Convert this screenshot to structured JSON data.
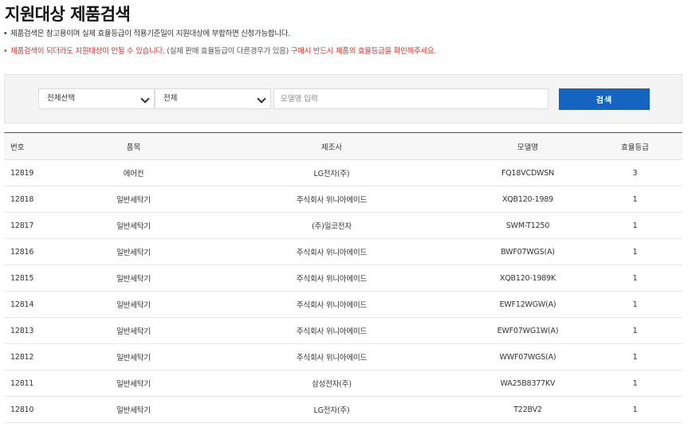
{
  "page": {
    "title": "지원대상 제품검색",
    "notes": {
      "line1": "제품검색은 참고용이며 실제 효율등급이 적용기준일이 지원대상에 부합하면 신청가능합니다.",
      "line2_red1": "제품검색이 되더라도 지원대상이 안될 수 있습니다.",
      "line2_gray": " (실제 판매 효율등급이 다른경우가 있음) ",
      "line2_red2": "구매시 반드시 제품의 효율등급을 확인해주세요."
    }
  },
  "search": {
    "select1_value": "전체선택",
    "select2_value": "전체",
    "model_placeholder": "모델명 입력",
    "button_label": "검색"
  },
  "table": {
    "headers": {
      "no": "번호",
      "item": "품목",
      "maker": "제조사",
      "model": "모델명",
      "grade": "효율등급"
    },
    "rows": [
      {
        "no": "12819",
        "item": "에어컨",
        "maker": "LG전자(주)",
        "model": "FQ18VCDWSN",
        "grade": "3"
      },
      {
        "no": "12818",
        "item": "일반세탁기",
        "maker": "주식회사 위니아에이드",
        "model": "XQB120-1989",
        "grade": "1"
      },
      {
        "no": "12817",
        "item": "일반세탁기",
        "maker": "(주)일코전자",
        "model": "SWM-T1250",
        "grade": "1"
      },
      {
        "no": "12816",
        "item": "일반세탁기",
        "maker": "주식회사 위니아에이드",
        "model": "BWF07WGS(A)",
        "grade": "1"
      },
      {
        "no": "12815",
        "item": "일반세탁기",
        "maker": "주식회사 위니아에이드",
        "model": "XQB120-1989K",
        "grade": "1"
      },
      {
        "no": "12814",
        "item": "일반세탁기",
        "maker": "주식회사 위니아에이드",
        "model": "EWF12WGW(A)",
        "grade": "1"
      },
      {
        "no": "12813",
        "item": "일반세탁기",
        "maker": "주식회사 위니아에이드",
        "model": "EWF07WG1W(A)",
        "grade": "1"
      },
      {
        "no": "12812",
        "item": "일반세탁기",
        "maker": "주식회사 위니아에이드",
        "model": "WWF07WGS(A)",
        "grade": "1"
      },
      {
        "no": "12811",
        "item": "일반세탁기",
        "maker": "삼성전자(주)",
        "model": "WA25B8377KV",
        "grade": "1"
      },
      {
        "no": "12810",
        "item": "일반세탁기",
        "maker": "LG전자(주)",
        "model": "T22BV2",
        "grade": "1"
      }
    ]
  }
}
